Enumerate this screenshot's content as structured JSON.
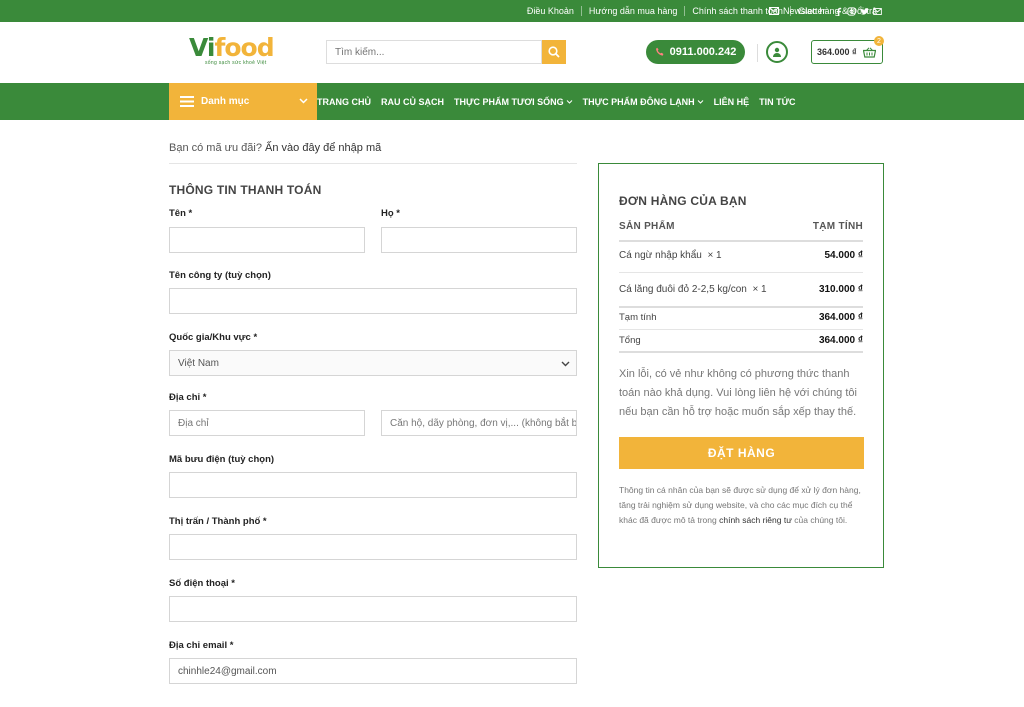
{
  "topbar": {
    "links": [
      "Điều Khoản",
      "Hướng dẫn mua hàng",
      "Chính sách thanh toán",
      "Giao hàng & Đổi trả"
    ],
    "newsletter": "Newsletter",
    "social_icons": [
      "facebook-icon",
      "instagram-icon",
      "twitter-icon",
      "mail-icon"
    ]
  },
  "header": {
    "logo_main_1": "Vi",
    "logo_main_2": "food",
    "logo_tagline": "sống sạch sức khoẻ Việt",
    "search_placeholder": "Tìm kiếm...",
    "phone": "0911.000.242",
    "cart_total": "364.000 ₫",
    "cart_count": "2"
  },
  "nav": {
    "category_label": "Danh mục",
    "items": [
      "TRANG CHỦ",
      "RAU CỦ SẠCH",
      "THỰC PHẨM TƯƠI SỐNG",
      "THỰC PHẨM ĐÔNG LẠNH",
      "LIÊN HỆ",
      "TIN TỨC"
    ]
  },
  "coupon": {
    "text": "Bạn có mã ưu đãi?",
    "link": "Ấn vào đây để nhập mã"
  },
  "billing": {
    "title": "THÔNG TIN THANH TOÁN",
    "first_name_label": "Tên *",
    "last_name_label": "Họ *",
    "company_label": "Tên công ty (tuỳ chọn)",
    "country_label": "Quốc gia/Khu vực *",
    "country_value": "Việt Nam",
    "address_label": "Địa chỉ *",
    "address_placeholder": "Địa chỉ",
    "address2_placeholder": "Căn hộ, dãy phòng, đơn vị,... (không bắt buộc)",
    "postcode_label": "Mã bưu điện (tuỳ chọn)",
    "city_label": "Thị trấn / Thành phố *",
    "phone_label": "Số điện thoại *",
    "email_label": "Địa chỉ email *",
    "email_value": "chinhle24@gmail.com"
  },
  "order": {
    "title": "ĐƠN HÀNG CỦA BẠN",
    "col_product": "SẢN PHẨM",
    "col_subtotal": "TẠM TÍNH",
    "items": [
      {
        "name": "Cá ngừ nhập khẩu",
        "qty": "× 1",
        "price": "54.000 ₫"
      },
      {
        "name": "Cá lăng đuôi đỏ 2-2,5 kg/con",
        "qty": "× 1",
        "price": "310.000 ₫"
      }
    ],
    "subtotal_label": "Tạm tính",
    "subtotal_value": "364.000 ₫",
    "total_label": "Tổng",
    "total_value": "364.000 ₫",
    "no_payment_note": "Xin lỗi, có vẻ như không có phương thức thanh toán nào khả dụng. Vui lòng liên hệ với chúng tôi nếu bạn cần hỗ trợ hoặc muốn sắp xếp thay thế.",
    "place_order": "ĐẶT HÀNG",
    "privacy_text": "Thông tin cá nhân của bạn sẽ được sử dụng để xử lý đơn hàng, tăng trải nghiệm sử dụng website, và cho các mục đích cụ thể khác đã được mô tả trong",
    "privacy_link": "chính sách riêng tư",
    "privacy_tail": "của chúng tôi."
  },
  "colors": {
    "green": "#3a8a3a",
    "orange": "#f2b43a"
  }
}
